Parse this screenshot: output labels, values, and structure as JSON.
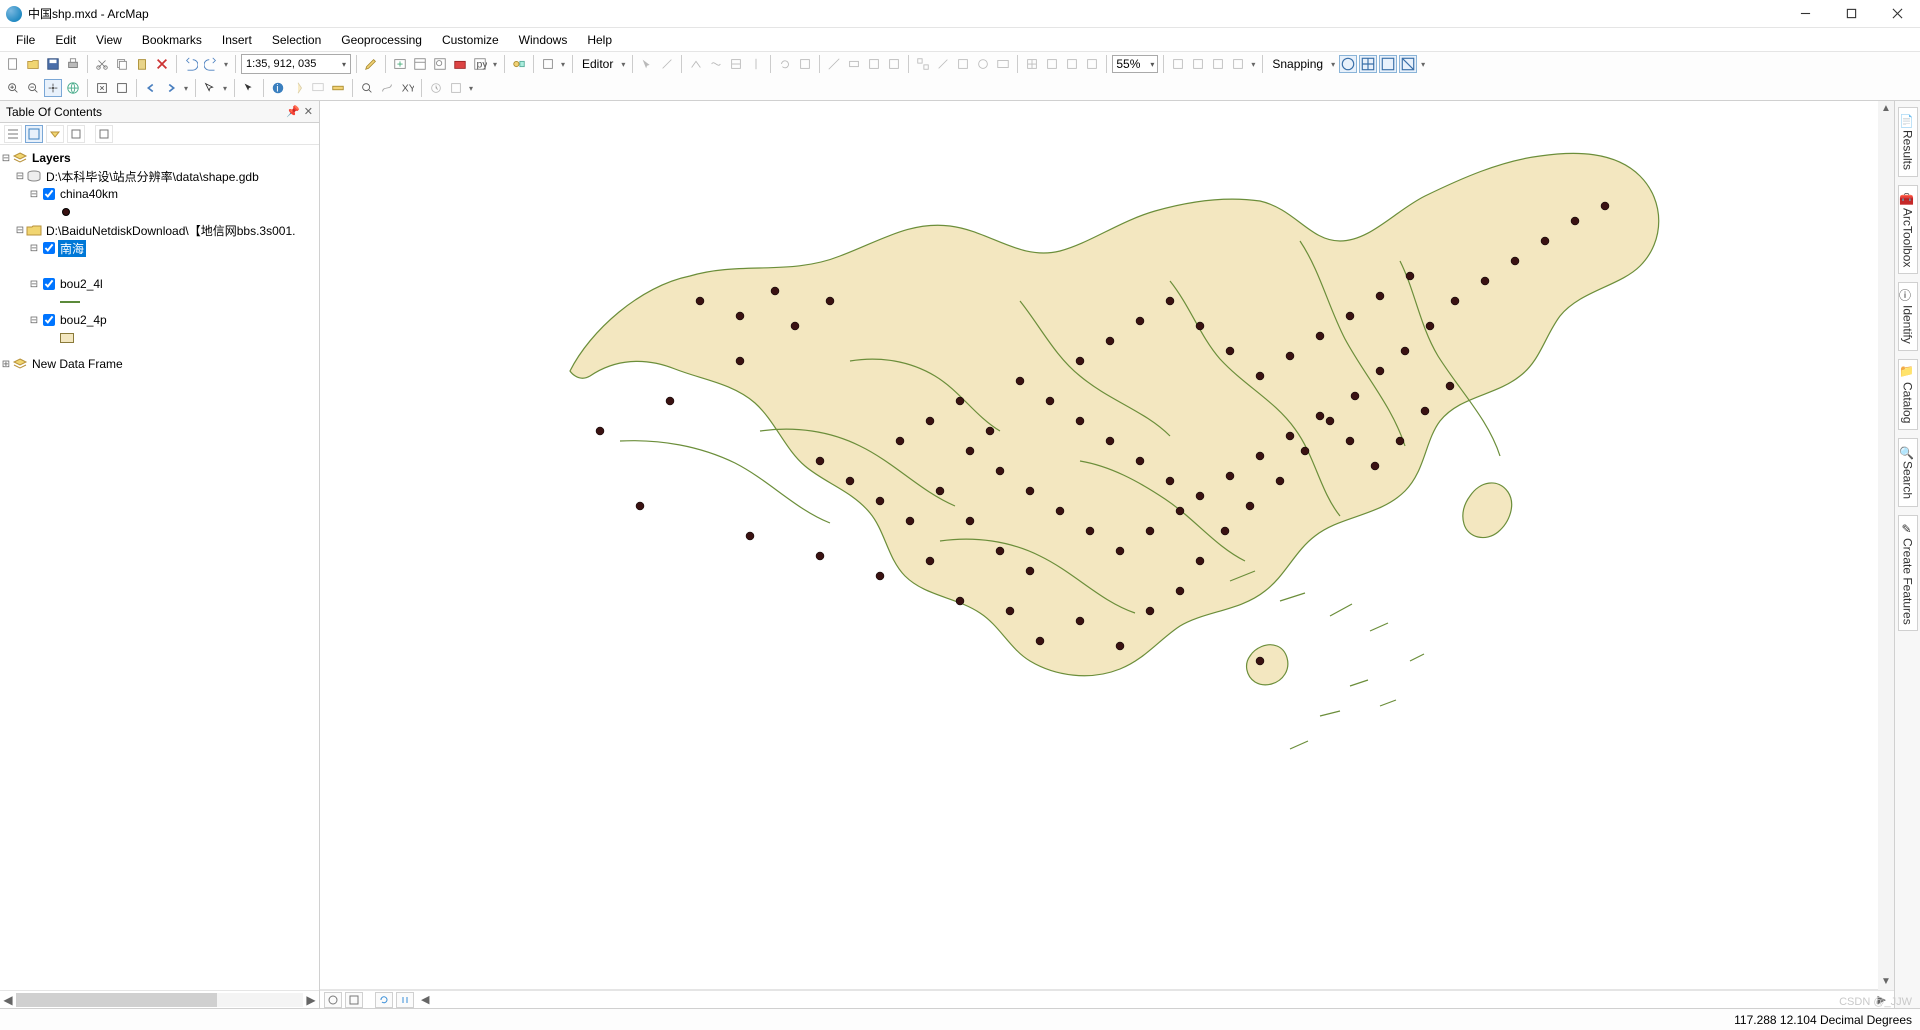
{
  "window": {
    "title": "中国shp.mxd - ArcMap"
  },
  "menu": {
    "items": [
      "File",
      "Edit",
      "View",
      "Bookmarks",
      "Insert",
      "Selection",
      "Geoprocessing",
      "Customize",
      "Windows",
      "Help"
    ]
  },
  "toolbar": {
    "scale": "1:35, 912, 035",
    "editor_label": "Editor",
    "zoom_pct": "55%",
    "snapping_label": "Snapping"
  },
  "toc": {
    "title": "Table Of Contents",
    "root": "Layers",
    "groups": [
      {
        "path": "D:\\本科毕设\\站点分辨率\\data\\shape.gdb",
        "layers": [
          {
            "name": "china40km",
            "checked": true,
            "symbol": "dot"
          }
        ]
      },
      {
        "path": "D:\\BaiduNetdiskDownload\\【地信网bbs.3s001.",
        "layers": [
          {
            "name": "南海",
            "checked": true,
            "selected": true,
            "symbol": ""
          },
          {
            "name": "bou2_4l",
            "checked": true,
            "symbol": "line"
          },
          {
            "name": "bou2_4p",
            "checked": true,
            "symbol": "poly"
          }
        ]
      }
    ],
    "extra_frame": "New Data Frame"
  },
  "right_dock": {
    "tabs": [
      "Results",
      "ArcToolbox",
      "Identify",
      "Catalog",
      "Search",
      "Create Features"
    ]
  },
  "statusbar": {
    "position": "117.288  12.104 Decimal Degrees"
  },
  "watermark": "CSDN @_JJW"
}
